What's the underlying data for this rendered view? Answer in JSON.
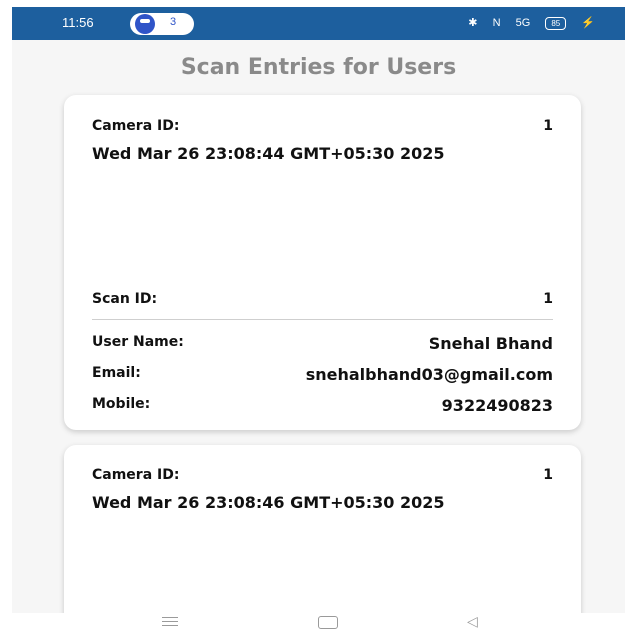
{
  "status_bar": {
    "time": "11:56",
    "notification_count": "3",
    "bluetooth_icon": "✱",
    "nfc_icon": "N",
    "signal_text": "5G",
    "battery": "85"
  },
  "page": {
    "title": "Scan Entries for Users"
  },
  "entries": [
    {
      "camera_label": "Camera ID:",
      "camera_id": "1",
      "timestamp": "Wed Mar 26 23:08:44 GMT+05:30 2025",
      "scan_label": "Scan ID:",
      "scan_id": "1",
      "user_name_label": "User Name:",
      "user_name": "Snehal Bhand",
      "email_label": "Email:",
      "email": "snehalbhand03@gmail.com",
      "mobile_label": "Mobile:",
      "mobile": "9322490823"
    },
    {
      "camera_label": "Camera ID:",
      "camera_id": "1",
      "timestamp": "Wed Mar 26 23:08:46 GMT+05:30 2025"
    }
  ],
  "nav_bar": {
    "back_glyph": "◁"
  },
  "colors": {
    "status_bar": "#1d5f9e",
    "title": "#8a8a8a",
    "card": "#ffffff"
  }
}
